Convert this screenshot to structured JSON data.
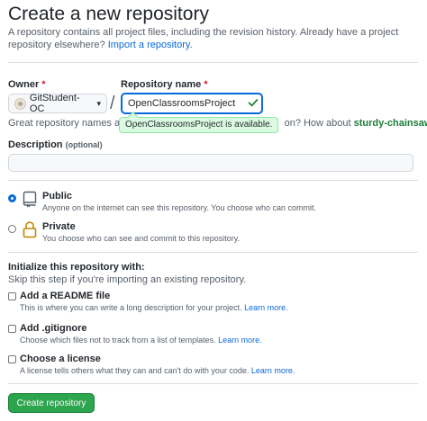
{
  "header": {
    "title": "Create a new repository",
    "subtitle": "A repository contains all project files, including the revision history. Already have a project repository elsewhere?",
    "import_link": "Import a repository."
  },
  "owner": {
    "label": "Owner",
    "required_mark": "*",
    "value": "GitStudent-OC",
    "caret": "▾"
  },
  "separator": "/",
  "repo_name": {
    "label": "Repository name",
    "required_mark": "*",
    "value": "OpenClassroomsProject",
    "availability_tooltip": "OpenClassroomsProject is available.",
    "hint_prefix": "Great repository names are sh",
    "hint_suffix": "on? How about",
    "suggestion": "sturdy-chainsaw"
  },
  "description": {
    "label": "Description",
    "optional": "(optional)",
    "value": "",
    "placeholder": ""
  },
  "visibility": {
    "options": [
      {
        "title": "Public",
        "desc": "Anyone on the internet can see this repository. You choose who can commit.",
        "checked": true
      },
      {
        "title": "Private",
        "desc": "You choose who can see and commit to this repository.",
        "checked": false
      }
    ]
  },
  "initialize": {
    "title": "Initialize this repository with:",
    "subtitle": "Skip this step if you're importing an existing repository.",
    "readme": {
      "title": "Add a README file",
      "desc": "This is where you can write a long description for your project.",
      "link": "Learn more."
    },
    "gitignore": {
      "title": "Add .gitignore",
      "desc": "Choose which files not to track from a list of templates.",
      "link": "Learn more."
    },
    "license": {
      "title": "Choose a license",
      "desc": "A license tells others what they can and can't do with your code.",
      "link": "Learn more."
    }
  },
  "actions": {
    "create_label": "Create repository"
  },
  "colors": {
    "primary": "#2da44e",
    "link": "#0969da",
    "success": "#1a7f37",
    "required": "#cf222e"
  }
}
